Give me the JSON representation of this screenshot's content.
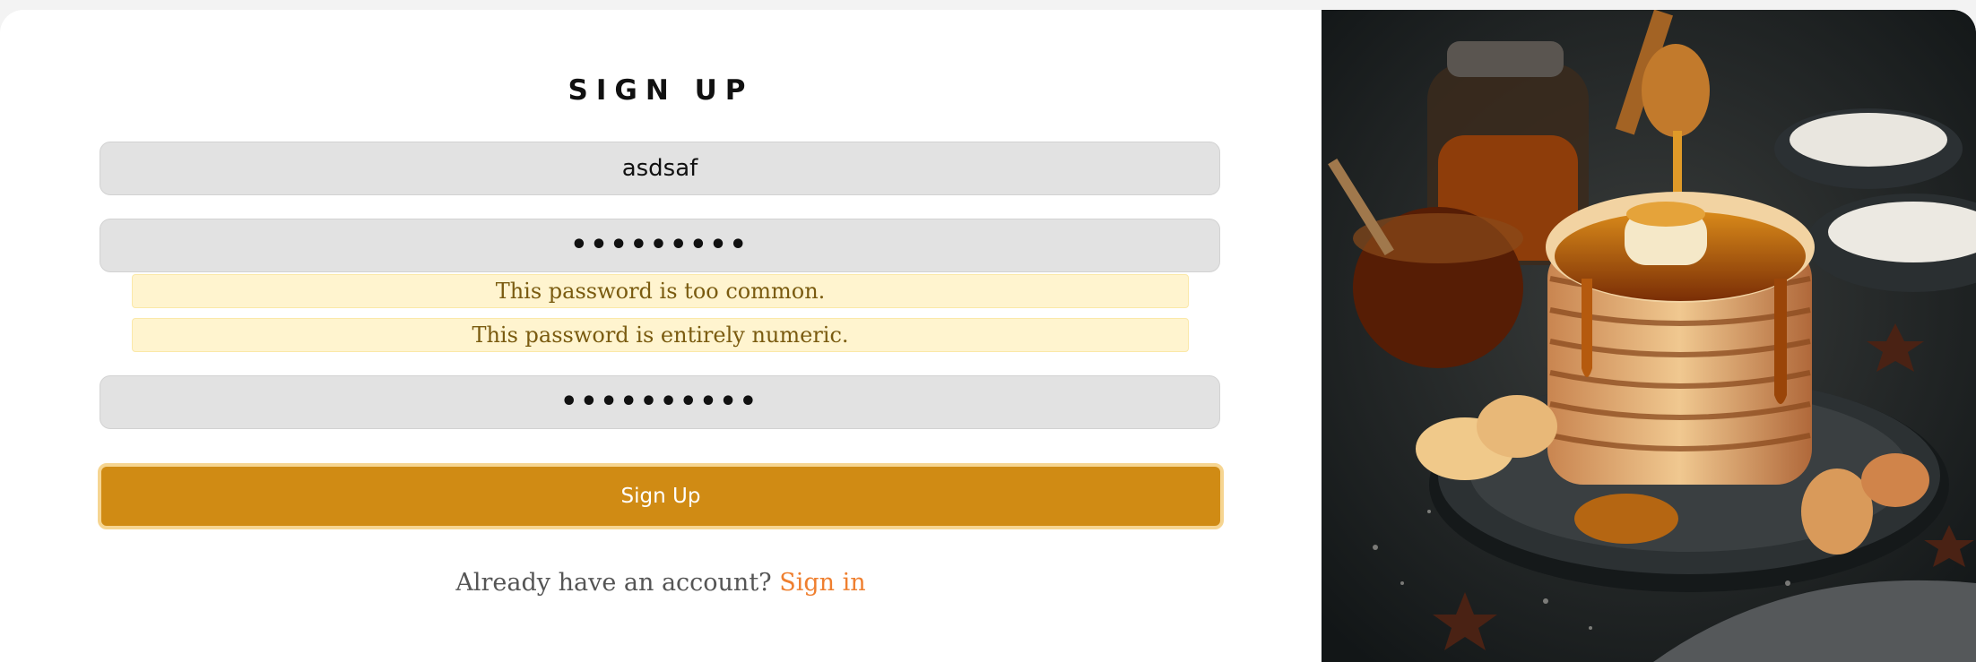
{
  "form": {
    "title": "SIGN UP",
    "username_value": "asdsaf",
    "password_value": "•••••••••",
    "confirm_value": "••••••••••",
    "errors": [
      "This password is too common.",
      "This password is entirely numeric."
    ],
    "submit_label": "Sign Up",
    "footer_text": "Already have an account? ",
    "footer_link": "Sign in"
  },
  "colors": {
    "accent": "#d08b14",
    "link": "#ef7f2f",
    "warning_bg": "#fff4cf",
    "warning_text": "#7a5b10"
  },
  "image": {
    "subject": "pancake-stack-with-honey"
  }
}
